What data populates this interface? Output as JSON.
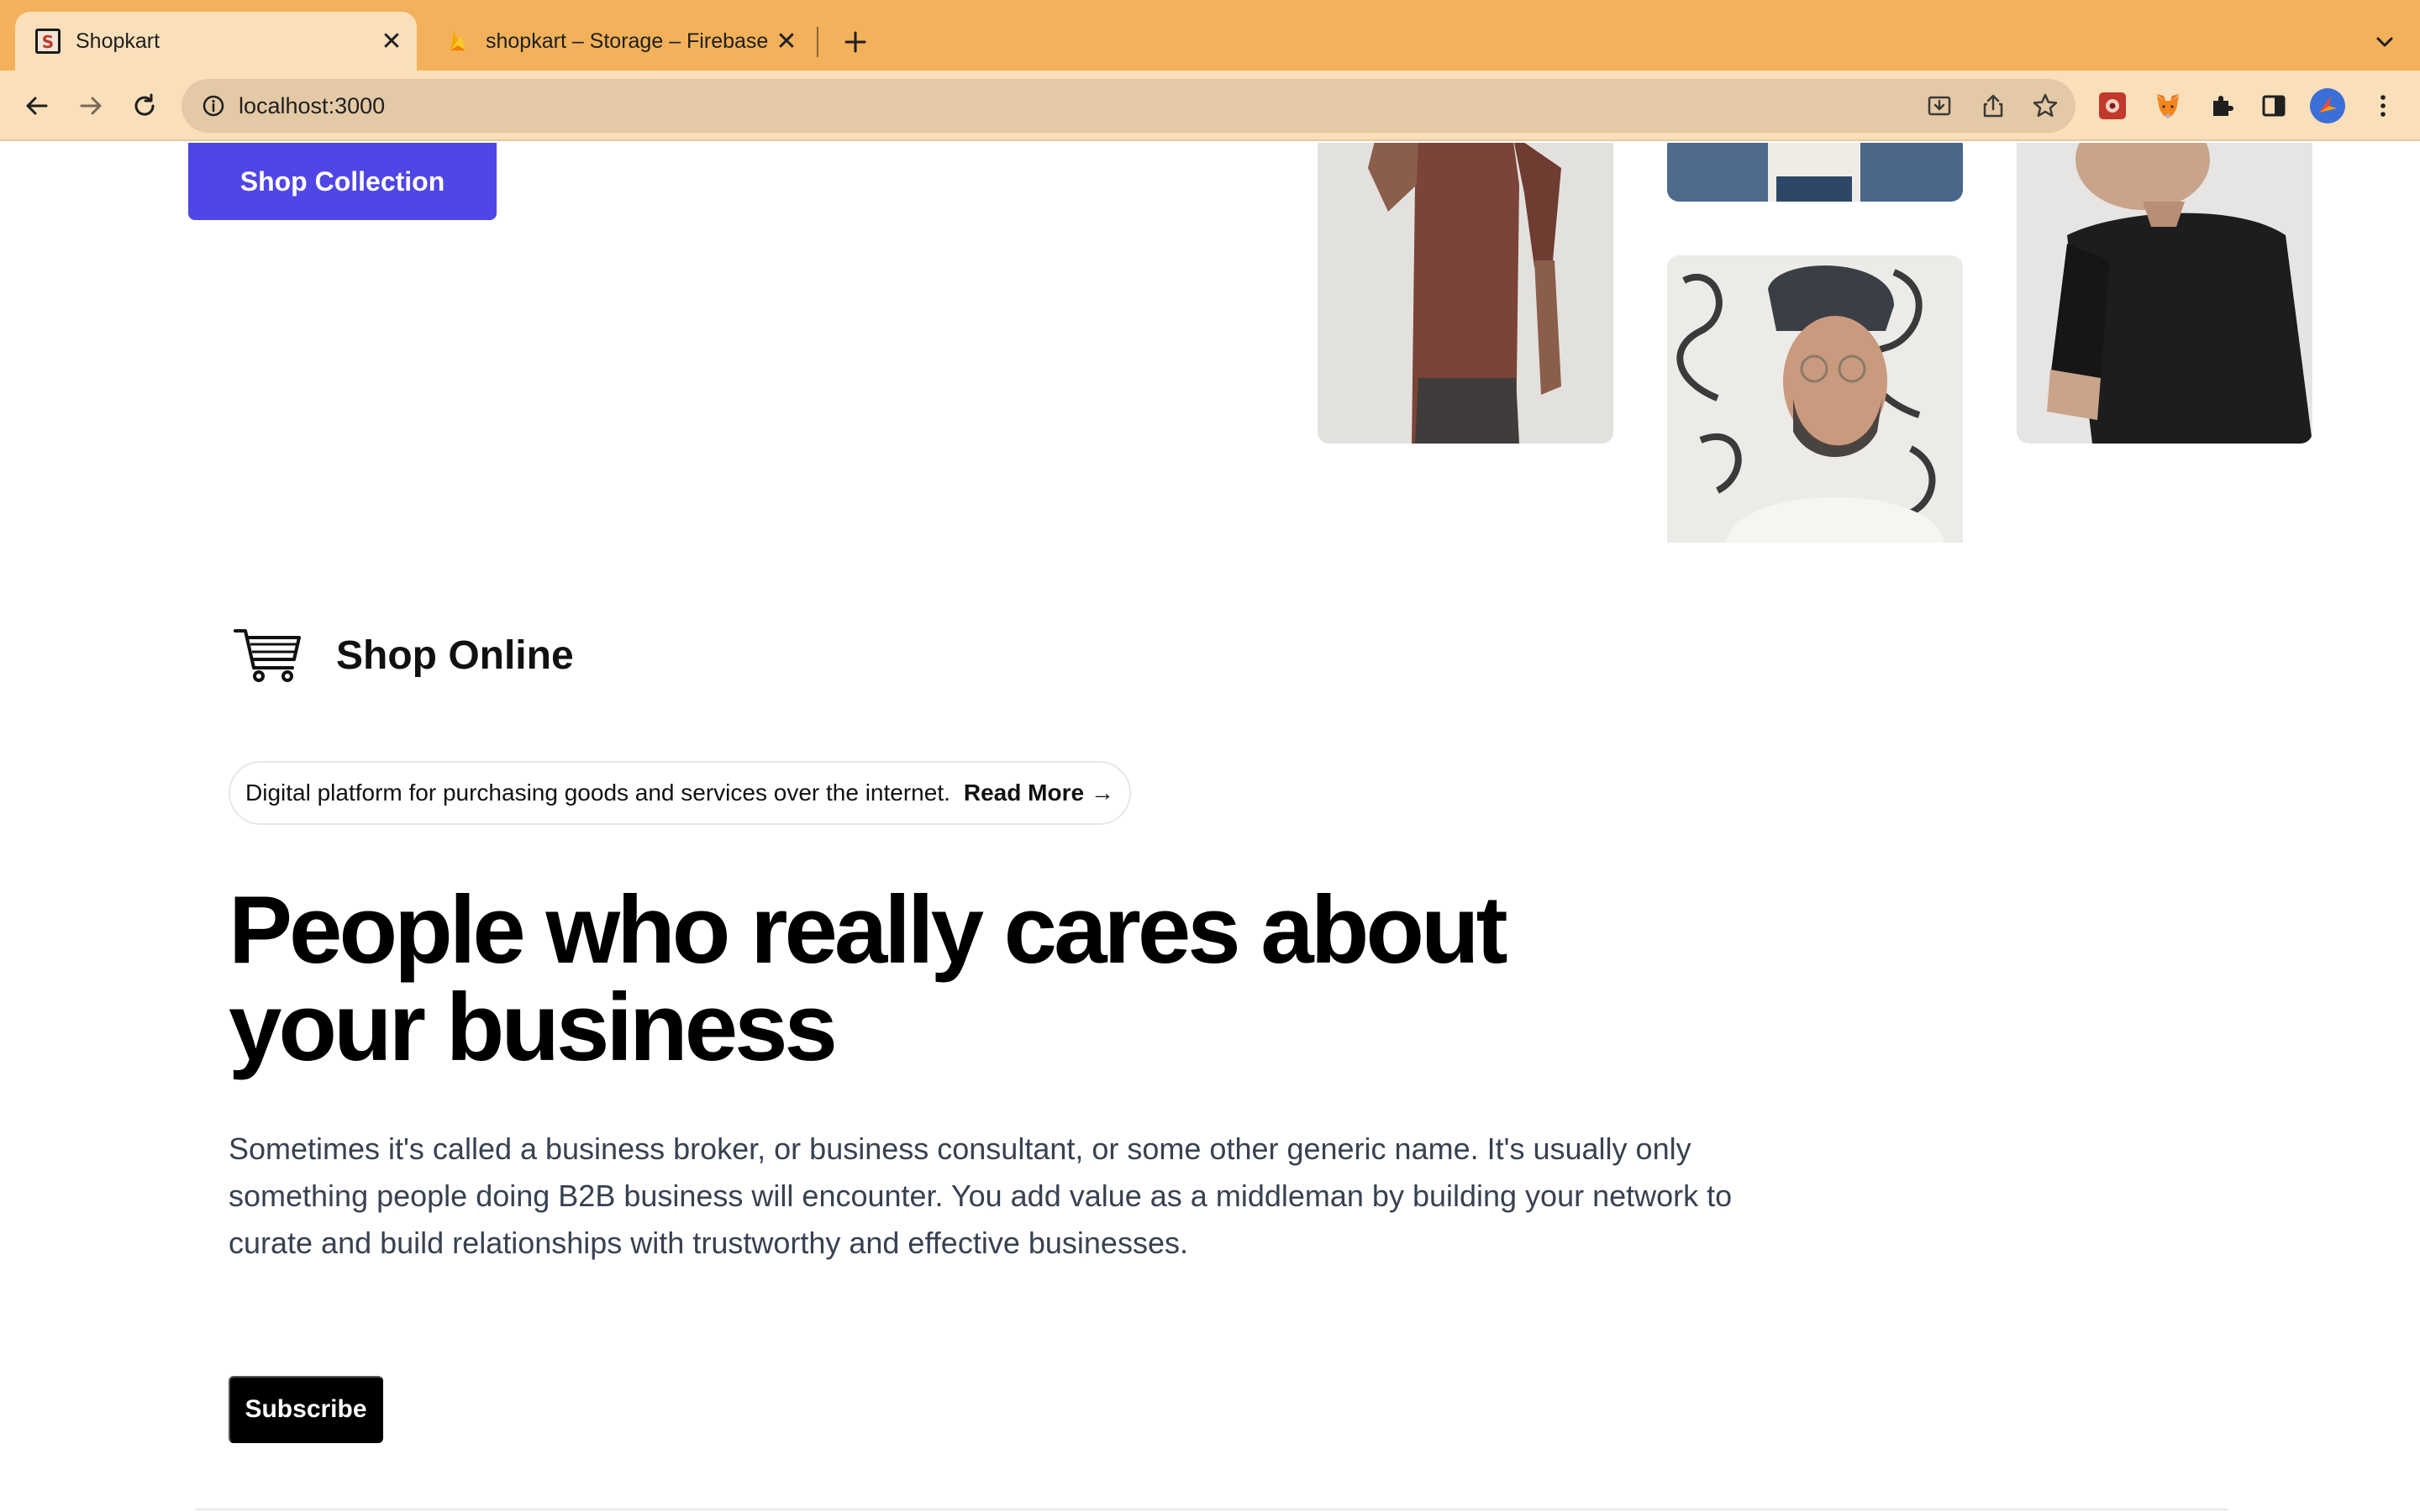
{
  "browser": {
    "tabs": [
      {
        "title": "Shopkart",
        "active": true
      },
      {
        "title": "shopkart – Storage – Firebase",
        "active": false
      }
    ],
    "url": "localhost:3000"
  },
  "hero": {
    "shop_button_label": "Shop Collection"
  },
  "brand": {
    "name": "Shop Online",
    "icon": "shopping-cart-icon"
  },
  "announcement": {
    "text": "Digital platform for purchasing goods and services over the internet.",
    "link_label": "Read More →"
  },
  "headline": "People who really cares about your business",
  "lead": "Sometimes it's called a business broker, or business consultant, or some other generic name. It's usually only something people doing B2B business will encounter. You add value as a middleman by building your network to curate and build relationships with trustworthy and effective businesses.",
  "cta": {
    "subscribe_label": "Subscribe"
  },
  "colors": {
    "tabstrip": "#f2b15a",
    "toolbar": "#f9dfba",
    "primary": "#4f46e5"
  }
}
